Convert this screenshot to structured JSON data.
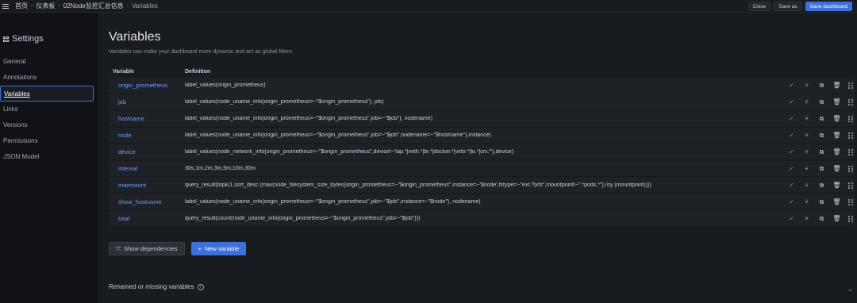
{
  "breadcrumb": [
    "首页",
    "仪表板",
    "02Node监控汇总信息",
    "Variables"
  ],
  "top_actions": {
    "close": "Close",
    "save_as": "Save as",
    "save": "Save dashboard"
  },
  "sidebar": {
    "title": "Settings",
    "items": [
      "General",
      "Annotations",
      "Variables",
      "Links",
      "Versions",
      "Permissions",
      "JSON Model"
    ],
    "active": "Variables"
  },
  "page": {
    "title": "Variables",
    "description": "Variables can make your dashboard more dynamic and act as global filters."
  },
  "table": {
    "headers": [
      "Variable",
      "Definition"
    ],
    "rows": [
      {
        "name": "origin_prometheus",
        "definition": "label_values(origin_prometheus)"
      },
      {
        "name": "job",
        "definition": "label_values(node_uname_info{origin_prometheus=~\"$origin_prometheus\"}, job)"
      },
      {
        "name": "hostname",
        "definition": "label_values(node_uname_info{origin_prometheus=~\"$origin_prometheus\",job=~\"$job\"}, nodename)"
      },
      {
        "name": "node",
        "definition": "label_values(node_uname_info{origin_prometheus=~\"$origin_prometheus\",job=~\"$job\",nodename=~\"$hostname\"},instance)"
      },
      {
        "name": "device",
        "definition": "label_values(node_network_info{origin_prometheus=~\"$origin_prometheus\",device!~'tap.*|veth.*|br.*|docker.*|virbr.*|lo.*|cni.*'},device)"
      },
      {
        "name": "interval",
        "definition": "30s,1m,2m,3m,5m,10m,30m"
      },
      {
        "name": "maxmount",
        "definition": "query_result(topk(1,sort_desc (max(node_filesystem_size_bytes{origin_prometheus=~\"$origin_prometheus\",instance=~'$node',fstype=~\"ext.?|xfs\",mountpoint!~\".*pods.*\"}) by (mountpoint))))"
      },
      {
        "name": "show_hostname",
        "definition": "label_values(node_uname_info{origin_prometheus=~\"$origin_prometheus\",job=~\"$job\",instance=~\"$node\"}, nodename)"
      },
      {
        "name": "total",
        "definition": "query_result(count(node_uname_info{origin_prometheus=~\"$origin_prometheus\",job=~\"$job\"}))"
      }
    ],
    "row_icons": [
      "check-icon",
      "branch-icon",
      "duplicate-icon",
      "trash-icon",
      "drag-handle-icon"
    ]
  },
  "buttons": {
    "show_dependencies": "Show dependencies",
    "new_variable": "New variable"
  },
  "renamed": {
    "label": "Renamed or missing variables"
  },
  "colors": {
    "accent": "#3d71d9",
    "link": "#6e9fff",
    "ok": "#3db87a",
    "bg": "#111217",
    "panel": "#181b1f"
  }
}
